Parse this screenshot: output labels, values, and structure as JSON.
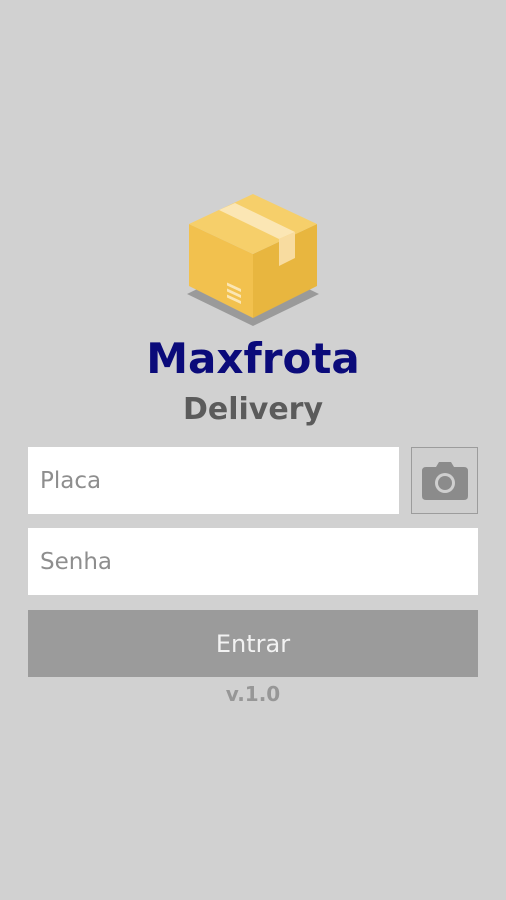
{
  "app": {
    "title": "Maxfrota",
    "subtitle": "Delivery",
    "version": "v.1.0"
  },
  "form": {
    "plate_placeholder": "Placa",
    "password_placeholder": "Senha",
    "login_label": "Entrar"
  },
  "icons": {
    "logo": "package-box-icon",
    "camera": "camera-icon"
  },
  "colors": {
    "background": "#d1d1d1",
    "title": "#0b0b7a",
    "subtitle": "#5b5b5b",
    "button": "#9b9b9b",
    "box": "#f0c050"
  }
}
